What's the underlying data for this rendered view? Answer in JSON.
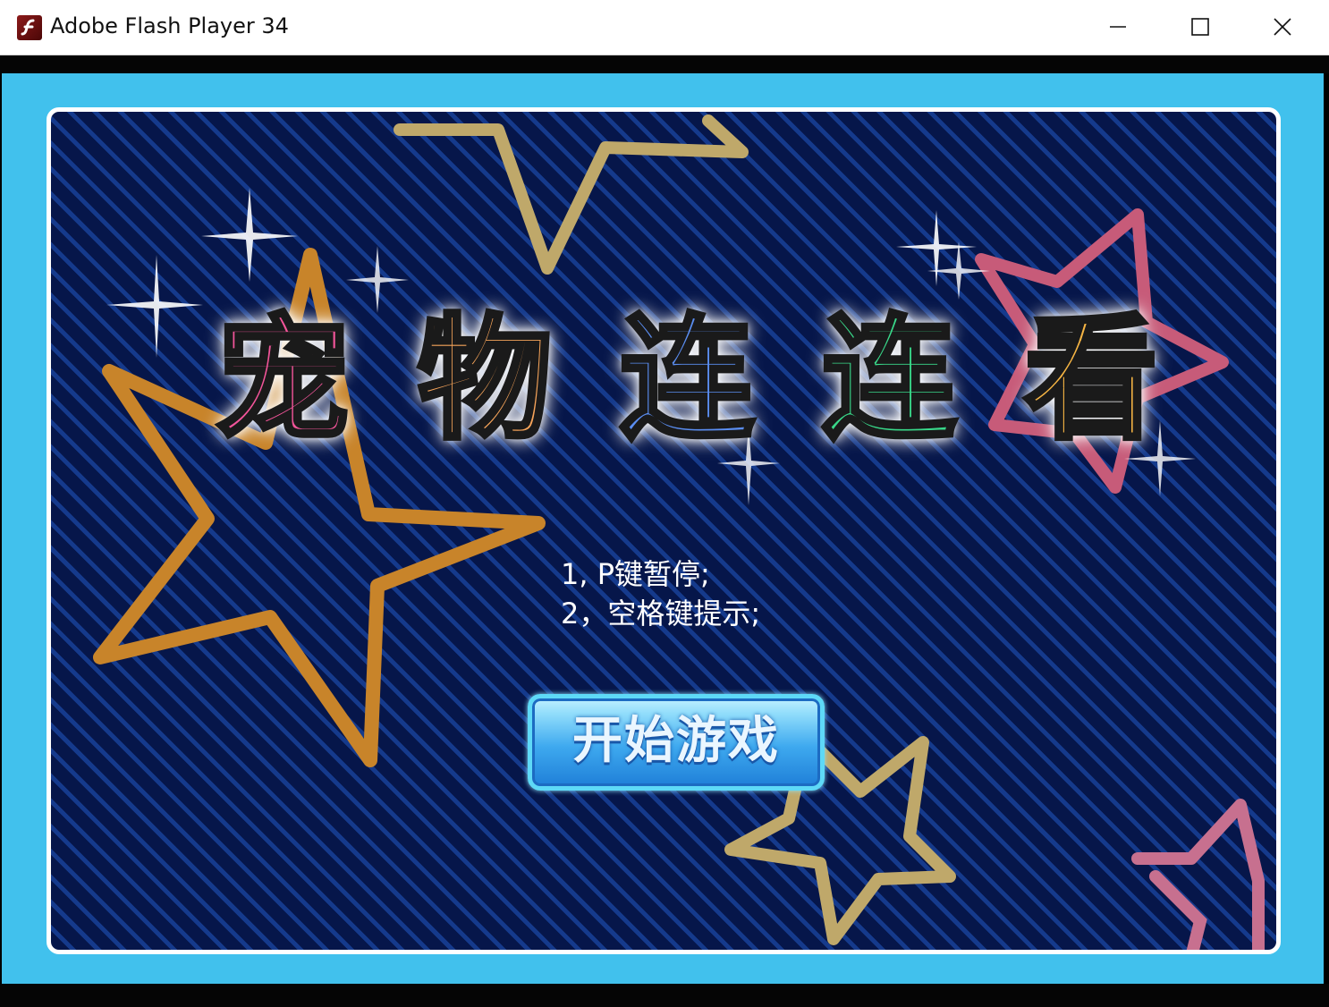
{
  "window": {
    "title": "Adobe Flash Player 34",
    "icon": "flash-player-icon",
    "controls": [
      "minimize-icon",
      "maximize-icon",
      "close-icon"
    ]
  },
  "colors": {
    "stage_background": "#41c1ed",
    "panel_background": "#06164a",
    "panel_stripes": "#153a8c",
    "button_gradient_top": "#bff0ff",
    "button_gradient_bottom": "#1f7fd8"
  },
  "game": {
    "logo": [
      "宠",
      "物",
      "连",
      "连",
      "看"
    ],
    "instructions": {
      "line1": "1, P键暂停;",
      "line2": "2，空格键提示;"
    },
    "start_button": {
      "label": "开始游戏"
    }
  }
}
